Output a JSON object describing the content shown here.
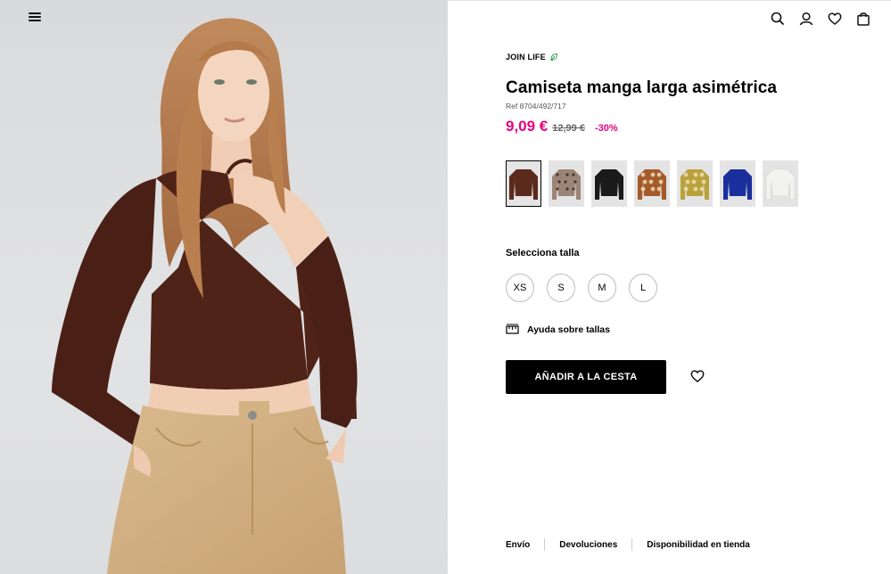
{
  "colors": {
    "price": "#e6007e",
    "button_bg": "#000000",
    "join_life_leaf": "#2e9b4e"
  },
  "header": {
    "icons": [
      "menu-icon",
      "search-icon",
      "user-icon",
      "heart-icon",
      "bag-icon"
    ]
  },
  "product": {
    "brand_tag": "JOIN LIFE",
    "title": "Camiseta manga larga asimétrica",
    "ref": "Ref 8704/492/717",
    "price_now": "9,09 €",
    "price_old": "12,99 €",
    "discount": "-30%"
  },
  "swatches": [
    {
      "color": "#5a2b1d",
      "pattern": "solid",
      "selected": true
    },
    {
      "color": "#9c8577",
      "pattern": "animal"
    },
    {
      "color": "#1a1a1a",
      "pattern": "solid"
    },
    {
      "color": "#a55a2a",
      "pattern": "floral"
    },
    {
      "color": "#b9a23a",
      "pattern": "floral"
    },
    {
      "color": "#1a2f9c",
      "pattern": "solid"
    },
    {
      "color": "#f2f2ee",
      "pattern": "solid"
    }
  ],
  "sizes": {
    "label": "Selecciona talla",
    "options": [
      "XS",
      "S",
      "M",
      "L"
    ]
  },
  "size_help": "Ayuda sobre tallas",
  "add_to_cart": "AÑADIR A LA CESTA",
  "footer": {
    "links": [
      "Envío",
      "Devoluciones",
      "Disponibilidad en tienda"
    ]
  }
}
